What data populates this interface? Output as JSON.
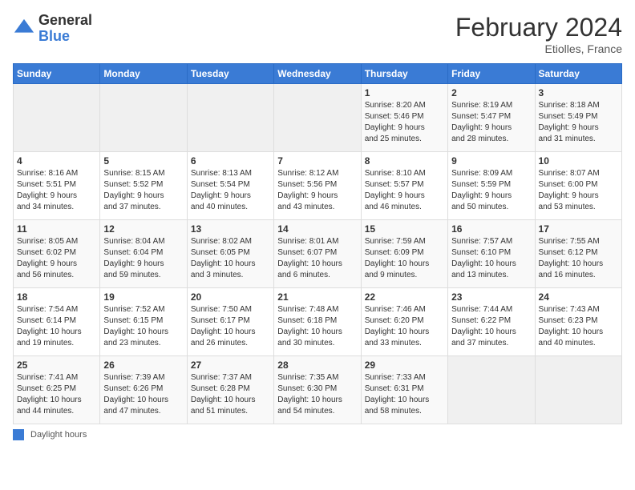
{
  "header": {
    "logo_general": "General",
    "logo_blue": "Blue",
    "month_title": "February 2024",
    "location": "Etiolles, France"
  },
  "days_of_week": [
    "Sunday",
    "Monday",
    "Tuesday",
    "Wednesday",
    "Thursday",
    "Friday",
    "Saturday"
  ],
  "weeks": [
    [
      {
        "day": "",
        "info": ""
      },
      {
        "day": "",
        "info": ""
      },
      {
        "day": "",
        "info": ""
      },
      {
        "day": "",
        "info": ""
      },
      {
        "day": "1",
        "info": "Sunrise: 8:20 AM\nSunset: 5:46 PM\nDaylight: 9 hours\nand 25 minutes."
      },
      {
        "day": "2",
        "info": "Sunrise: 8:19 AM\nSunset: 5:47 PM\nDaylight: 9 hours\nand 28 minutes."
      },
      {
        "day": "3",
        "info": "Sunrise: 8:18 AM\nSunset: 5:49 PM\nDaylight: 9 hours\nand 31 minutes."
      }
    ],
    [
      {
        "day": "4",
        "info": "Sunrise: 8:16 AM\nSunset: 5:51 PM\nDaylight: 9 hours\nand 34 minutes."
      },
      {
        "day": "5",
        "info": "Sunrise: 8:15 AM\nSunset: 5:52 PM\nDaylight: 9 hours\nand 37 minutes."
      },
      {
        "day": "6",
        "info": "Sunrise: 8:13 AM\nSunset: 5:54 PM\nDaylight: 9 hours\nand 40 minutes."
      },
      {
        "day": "7",
        "info": "Sunrise: 8:12 AM\nSunset: 5:56 PM\nDaylight: 9 hours\nand 43 minutes."
      },
      {
        "day": "8",
        "info": "Sunrise: 8:10 AM\nSunset: 5:57 PM\nDaylight: 9 hours\nand 46 minutes."
      },
      {
        "day": "9",
        "info": "Sunrise: 8:09 AM\nSunset: 5:59 PM\nDaylight: 9 hours\nand 50 minutes."
      },
      {
        "day": "10",
        "info": "Sunrise: 8:07 AM\nSunset: 6:00 PM\nDaylight: 9 hours\nand 53 minutes."
      }
    ],
    [
      {
        "day": "11",
        "info": "Sunrise: 8:05 AM\nSunset: 6:02 PM\nDaylight: 9 hours\nand 56 minutes."
      },
      {
        "day": "12",
        "info": "Sunrise: 8:04 AM\nSunset: 6:04 PM\nDaylight: 9 hours\nand 59 minutes."
      },
      {
        "day": "13",
        "info": "Sunrise: 8:02 AM\nSunset: 6:05 PM\nDaylight: 10 hours\nand 3 minutes."
      },
      {
        "day": "14",
        "info": "Sunrise: 8:01 AM\nSunset: 6:07 PM\nDaylight: 10 hours\nand 6 minutes."
      },
      {
        "day": "15",
        "info": "Sunrise: 7:59 AM\nSunset: 6:09 PM\nDaylight: 10 hours\nand 9 minutes."
      },
      {
        "day": "16",
        "info": "Sunrise: 7:57 AM\nSunset: 6:10 PM\nDaylight: 10 hours\nand 13 minutes."
      },
      {
        "day": "17",
        "info": "Sunrise: 7:55 AM\nSunset: 6:12 PM\nDaylight: 10 hours\nand 16 minutes."
      }
    ],
    [
      {
        "day": "18",
        "info": "Sunrise: 7:54 AM\nSunset: 6:14 PM\nDaylight: 10 hours\nand 19 minutes."
      },
      {
        "day": "19",
        "info": "Sunrise: 7:52 AM\nSunset: 6:15 PM\nDaylight: 10 hours\nand 23 minutes."
      },
      {
        "day": "20",
        "info": "Sunrise: 7:50 AM\nSunset: 6:17 PM\nDaylight: 10 hours\nand 26 minutes."
      },
      {
        "day": "21",
        "info": "Sunrise: 7:48 AM\nSunset: 6:18 PM\nDaylight: 10 hours\nand 30 minutes."
      },
      {
        "day": "22",
        "info": "Sunrise: 7:46 AM\nSunset: 6:20 PM\nDaylight: 10 hours\nand 33 minutes."
      },
      {
        "day": "23",
        "info": "Sunrise: 7:44 AM\nSunset: 6:22 PM\nDaylight: 10 hours\nand 37 minutes."
      },
      {
        "day": "24",
        "info": "Sunrise: 7:43 AM\nSunset: 6:23 PM\nDaylight: 10 hours\nand 40 minutes."
      }
    ],
    [
      {
        "day": "25",
        "info": "Sunrise: 7:41 AM\nSunset: 6:25 PM\nDaylight: 10 hours\nand 44 minutes."
      },
      {
        "day": "26",
        "info": "Sunrise: 7:39 AM\nSunset: 6:26 PM\nDaylight: 10 hours\nand 47 minutes."
      },
      {
        "day": "27",
        "info": "Sunrise: 7:37 AM\nSunset: 6:28 PM\nDaylight: 10 hours\nand 51 minutes."
      },
      {
        "day": "28",
        "info": "Sunrise: 7:35 AM\nSunset: 6:30 PM\nDaylight: 10 hours\nand 54 minutes."
      },
      {
        "day": "29",
        "info": "Sunrise: 7:33 AM\nSunset: 6:31 PM\nDaylight: 10 hours\nand 58 minutes."
      },
      {
        "day": "",
        "info": ""
      },
      {
        "day": "",
        "info": ""
      }
    ]
  ],
  "footer": {
    "legend_label": "Daylight hours"
  }
}
